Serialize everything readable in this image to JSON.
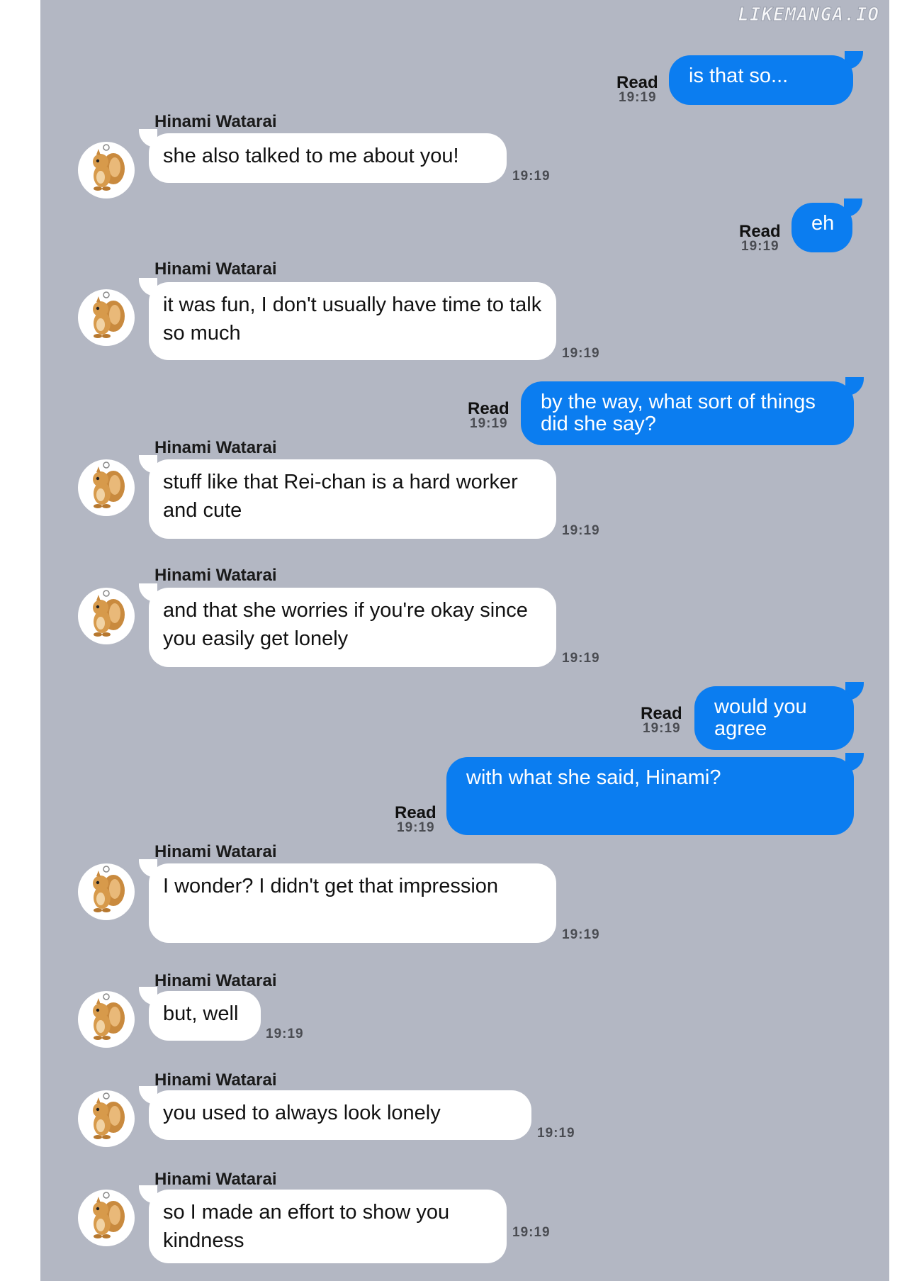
{
  "watermark": "LIKEMANGA.IO",
  "colors": {
    "background": "#b3b7c3",
    "outgoing": "#0b7df0",
    "incoming": "#ffffff"
  },
  "contact": {
    "name": "Hinami Watarai",
    "avatar_icon": "squirrel-icon"
  },
  "messages": [
    {
      "dir": "out",
      "text": "is that so...",
      "read": "Read",
      "time": "19:19"
    },
    {
      "dir": "in",
      "sender": "Hinami Watarai",
      "text": "she also talked to me about you!",
      "time": "19:19"
    },
    {
      "dir": "out",
      "text": "eh",
      "read": "Read",
      "time": "19:19"
    },
    {
      "dir": "in",
      "sender": "Hinami Watarai",
      "text": "it was fun, I don't usually have time to talk so much",
      "time": "19:19"
    },
    {
      "dir": "out",
      "text": "by the way, what sort of things did she say?",
      "read": "Read",
      "time": "19:19"
    },
    {
      "dir": "in",
      "sender": "Hinami Watarai",
      "text": "stuff like that Rei-chan is a hard worker and cute",
      "time": "19:19"
    },
    {
      "dir": "in",
      "sender": "Hinami Watarai",
      "text": "and that she worries if you're okay since you easily get lonely",
      "time": "19:19"
    },
    {
      "dir": "out",
      "text": "would you agree",
      "read": "Read",
      "time": "19:19"
    },
    {
      "dir": "out",
      "text": "with what she said, Hinami?",
      "read": "Read",
      "time": "19:19"
    },
    {
      "dir": "in",
      "sender": "Hinami Watarai",
      "text": "I wonder? I didn't get that impression",
      "time": "19:19"
    },
    {
      "dir": "in",
      "sender": "Hinami Watarai",
      "text": "but, well",
      "time": "19:19"
    },
    {
      "dir": "in",
      "sender": "Hinami Watarai",
      "text": "you used to always look lonely",
      "time": "19:19"
    },
    {
      "dir": "in",
      "sender": "Hinami Watarai",
      "text": "so I made an effort to show you kindness",
      "time": "19:19"
    }
  ]
}
